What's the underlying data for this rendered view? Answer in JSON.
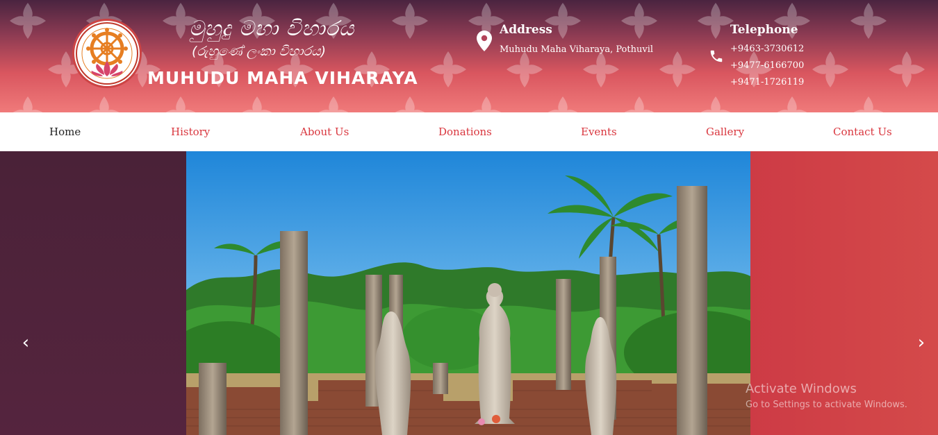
{
  "header": {
    "logo": {
      "sinhala_title": "මුහුදු මහා විහාරය",
      "sinhala_subtitle": "(රුහුණේ ලංකා විහාරය)",
      "name": "MUHUDU MAHA VIHARAYA",
      "emblem_icon": "dharma-wheel-lotus-icon"
    },
    "address": {
      "title": "Address",
      "value": "Muhudu Maha Viharaya, Pothuvil",
      "icon": "map-pin-icon"
    },
    "telephone": {
      "title": "Telephone",
      "numbers": [
        "+9463-3730612",
        "+9477-6166700",
        "+9471-1726119"
      ],
      "icon": "phone-icon"
    }
  },
  "nav": {
    "items": [
      {
        "label": "Home",
        "active": true
      },
      {
        "label": "History"
      },
      {
        "label": "About Us"
      },
      {
        "label": "Donations"
      },
      {
        "label": "Events"
      },
      {
        "label": "Gallery"
      },
      {
        "label": "Contact Us"
      }
    ]
  },
  "slider": {
    "prev_icon": "chevron-left-icon",
    "next_icon": "chevron-right-icon",
    "prev_glyph": "‹",
    "next_glyph": "›"
  },
  "watermark": {
    "title": "Activate Windows",
    "subtitle": "Go to Settings to activate Windows."
  },
  "colors": {
    "accent": "#d9363e",
    "header_dark": "#4a2440",
    "header_light": "#f07a7a",
    "slider_left": "#4a2238",
    "slider_right": "#cd3b45"
  }
}
